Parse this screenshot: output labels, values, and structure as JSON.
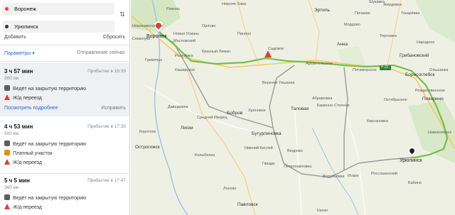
{
  "search": {
    "from": "Воронеж",
    "to": "Урюпинск",
    "add": "Добавить",
    "reset": "Сбросить",
    "swap_icon": "swap-icon"
  },
  "options": {
    "params": "Параметры ▾",
    "departure": "Отправление сейчас"
  },
  "routes": [
    {
      "time": "3 ч 57 мин",
      "distance": "300 км",
      "arrival": "Прибытие в 16:39",
      "warnings": [
        "Ведёт на закрытую территорию",
        "Ж/д переезд"
      ],
      "more": "Посмотреть подробнее",
      "fix": "Исправить"
    },
    {
      "time": "4 ч 53 мин",
      "distance": "300 км",
      "arrival": "Прибытие в 17:35",
      "warnings": [
        "Ведёт на закрытую территорию",
        "Платный участок",
        "Ж/д переезд"
      ]
    },
    {
      "time": "5 ч 5 мин",
      "distance": "360 км",
      "arrival": "Прибытие в 17:47",
      "warnings": [
        "Ведёт на закрытую территорию",
        "Ж/д переезд"
      ]
    }
  ],
  "map": {
    "start_city": "Воронеж",
    "end_city": "Урюпинск",
    "route_color": "#6fc24a",
    "alt_route_color": "#9a9a9a",
    "labels": [
      "Новоживотинное",
      "Рамонь",
      "Семилуки",
      "Новая Усмань",
      "Масловский",
      "Нижняя Хава",
      "Рогачёвка",
      "Панино",
      "Красный Лиман",
      "Садовое",
      "Эртиль",
      "Анна",
      "Архангельское",
      "Пятиморское",
      "Грибановский",
      "Борисоглебск",
      "Ольшанка",
      "Поворино",
      "Новохопёрск",
      "Бутурлиновка",
      "Таловая",
      "Абрамовка",
      "Каменно-Степное",
      "Бобров",
      "Хреновое",
      "Лиски",
      "Давыдовка",
      "Острогожск",
      "Россошанский",
      "Павловск",
      "Калач",
      "Новохопёрск",
      "Урюпинск",
      "Верхняя Тишанка",
      "Каширское",
      "Коротояк",
      "Ведрово",
      "Колыбелка",
      "Петропавловка",
      "Рождественское",
      "Новоживотинное",
      "Гремячье",
      "Лосево",
      "Воробьёвка",
      "Шукавка",
      "Октябрьское",
      "Искра",
      "Нижний Кисляй",
      "Гвазда",
      "Бабино",
      "Орлово",
      "Пичаево",
      "Жердевка",
      "Токарёвка",
      "Мордово",
      "Терновка",
      "Народное",
      "Новоусманское",
      "Средний Икорец",
      "Кирсановка",
      "Павловская"
    ],
    "road_badge": "Р-22"
  }
}
